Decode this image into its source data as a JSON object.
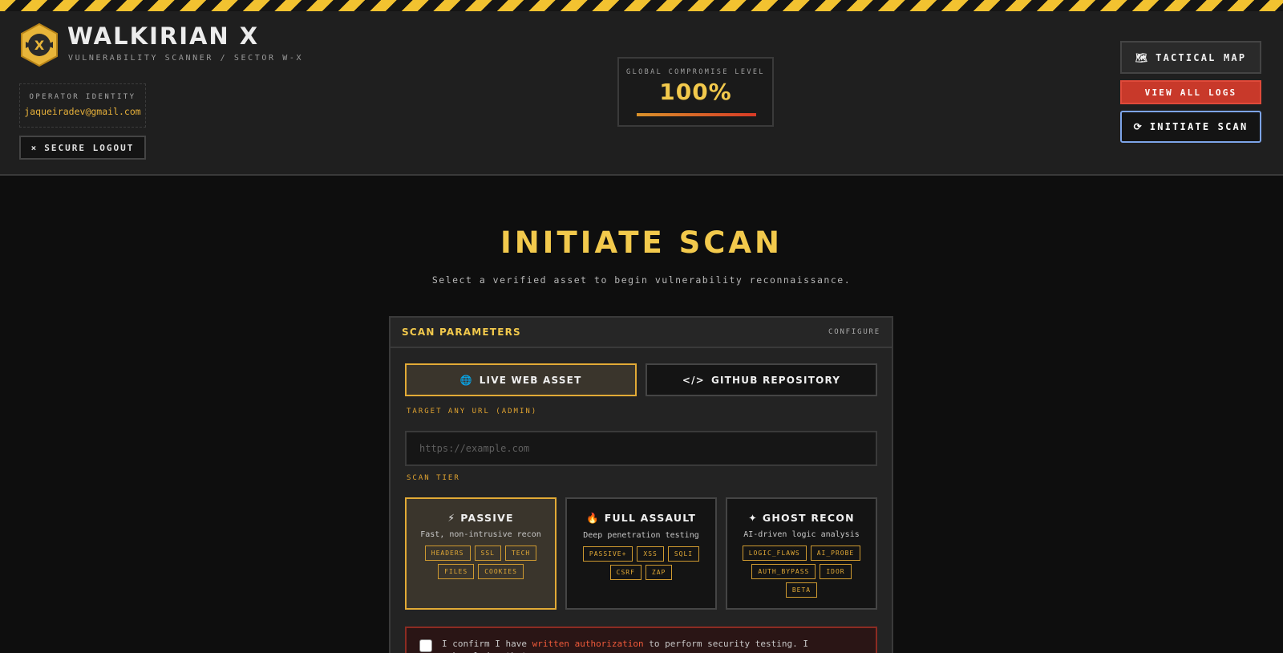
{
  "brand": {
    "title": "WALKIRIAN X",
    "subtitle": "VULNERABILITY SCANNER / SECTOR W-X",
    "logo_icon": "winged-shield-x-icon"
  },
  "operator": {
    "label": "OPERATOR IDENTITY",
    "email": "jaqueiradev@gmail.com"
  },
  "logout": {
    "icon": "×",
    "label": "SECURE LOGOUT"
  },
  "compromise": {
    "label": "GLOBAL COMPROMISE LEVEL",
    "value": "100%",
    "fraction": 1.0
  },
  "actions": {
    "map": {
      "icon": "🗺",
      "label": "TACTICAL MAP"
    },
    "logs": {
      "label": "VIEW ALL LOGS"
    },
    "scan": {
      "icon": "⟳",
      "label": "INITIATE SCAN"
    }
  },
  "main": {
    "title": "INITIATE SCAN",
    "subtitle": "Select a verified asset to begin vulnerability reconnaissance."
  },
  "panel": {
    "title": "SCAN PARAMETERS",
    "configure": "CONFIGURE",
    "tabs": [
      {
        "icon": "🌐",
        "label": "LIVE WEB ASSET",
        "active": true
      },
      {
        "icon": "</>",
        "label": "GITHUB REPOSITORY",
        "active": false
      }
    ],
    "url_label": "TARGET ANY URL (ADMIN)",
    "url_placeholder": "https://example.com",
    "url_value": "",
    "tier_label": "SCAN TIER",
    "tiers": [
      {
        "icon": "⚡",
        "name": "PASSIVE",
        "desc": "Fast, non-intrusive recon",
        "tags": [
          "HEADERS",
          "SSL",
          "TECH",
          "FILES",
          "COOKIES"
        ],
        "active": true
      },
      {
        "icon": "🔥",
        "name": "FULL ASSAULT",
        "desc": "Deep penetration testing",
        "tags": [
          "PASSIVE+",
          "XSS",
          "SQLI",
          "CSRF",
          "ZAP"
        ],
        "active": false
      },
      {
        "icon": "✦",
        "name": "GHOST RECON",
        "desc": "AI-driven logic analysis",
        "tags": [
          "LOGIC_FLAWS",
          "AI_PROBE",
          "AUTH_BYPASS",
          "IDOR",
          "BETA"
        ],
        "active": false
      }
    ],
    "consent": {
      "pre": "I confirm I have ",
      "emphasis": "written authorization",
      "post": " to perform security testing. I acknowledge that",
      "checked": false
    }
  },
  "colors": {
    "accent": "#f2c94c",
    "danger": "#c8392a",
    "focus": "#7da4e8"
  }
}
